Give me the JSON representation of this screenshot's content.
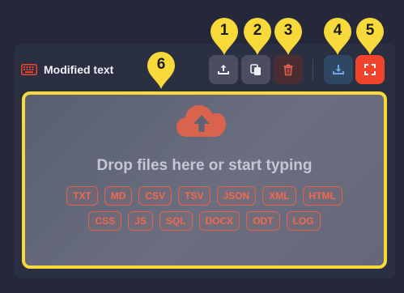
{
  "editor": {
    "title": "Modified text",
    "title_icon": "keyboard-icon",
    "accent_color": "#f0442c"
  },
  "toolbar": {
    "buttons": [
      {
        "name": "upload-button",
        "icon": "upload-icon"
      },
      {
        "name": "paste-button",
        "icon": "paste-icon"
      },
      {
        "name": "delete-button",
        "icon": "trash-icon"
      },
      {
        "name": "download-button",
        "icon": "download-icon"
      },
      {
        "name": "fullscreen-button",
        "icon": "fullscreen-icon"
      }
    ]
  },
  "annotations": [
    "1",
    "2",
    "3",
    "4",
    "5",
    "6"
  ],
  "dropzone": {
    "icon": "cloud-upload-icon",
    "title": "Drop files here or start typing",
    "formats": [
      "TXT",
      "MD",
      "CSV",
      "TSV",
      "JSON",
      "XML",
      "HTML",
      "CSS",
      "JS",
      "SQL",
      "DOCX",
      "ODT",
      "LOG"
    ]
  },
  "colors": {
    "background": "#24283a",
    "highlight": "#f7d93a",
    "chip": "#e2624a"
  }
}
